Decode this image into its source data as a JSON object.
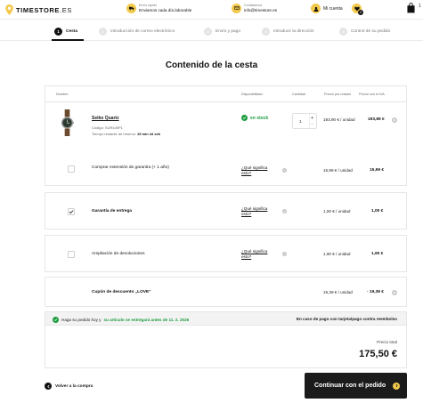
{
  "header": {
    "brand": "TIMESTORE",
    "brand_tld": ".ES",
    "shipping_small": "Envío rápido",
    "shipping_big": "Enviamos cada día laborable",
    "contact_small": "Contáctenos",
    "contact_big": "info@timestore.es",
    "account_label": "Mi cuenta",
    "favorites_count": "0",
    "cart_count": "1"
  },
  "steps": [
    {
      "num": "1",
      "label": "Cesta"
    },
    {
      "num": "2",
      "label": "Introducción de correo electrónico"
    },
    {
      "num": "3",
      "label": "Envío y pago"
    },
    {
      "num": "4",
      "label": "Introducir la dirección"
    },
    {
      "num": "5",
      "label": "Control de su pedido"
    }
  ],
  "page_title": "Contenido de la cesta",
  "table_headers": {
    "name": "Nombre",
    "availability": "Disponibilidad",
    "quantity": "Cantidad",
    "unit_price": "Precio por unidad",
    "vat_price": "Precio con el IVA"
  },
  "product": {
    "name": "Seiko Quartz",
    "code": "Código: SUR449P1",
    "time_prefix": "Tiempo restante de reserva:",
    "time_value": "19 min 44 sek",
    "stock": "en stock",
    "qty": "1",
    "qty_plus": "+",
    "qty_minus": "−",
    "unit_price": "193,90 € / unidad",
    "total": "193,89 €"
  },
  "options": [
    {
      "label": "Comprar extensión de garantía (+ 1 año)",
      "link": "¿Qué significa esto?",
      "unit": "15,99 € / unidad",
      "total": "15,99 €",
      "checked": false
    },
    {
      "label": "Garantía de entrega",
      "link": "¿Qué significa esto?",
      "unit": "1,00 € / unidad",
      "total": "1,00 €",
      "checked": true
    },
    {
      "label": "Ampliación de devoluciones",
      "link": "¿Qué significa esto?",
      "unit": "1,90 € / unidad",
      "total": "1,90 €",
      "checked": false
    }
  ],
  "coupon": {
    "label": "Cupón de descuento „LOVE“",
    "unit": "19,39 € / unidad",
    "total": "- 19,39 €"
  },
  "delivery": {
    "prefix": "Haga su pedido hoy y",
    "highlight": "su artículo se entregará antes de 11. 2. 2026",
    "right": "En caso de pago con tarjeta/pago contra reembolso"
  },
  "summary": {
    "total_label": "Precio total",
    "total_value": "175,50 €"
  },
  "actions": {
    "back": "Volver a la compra",
    "continue": "Continuar con el pedido"
  },
  "colors": {
    "accent": "#f2c94c",
    "success": "#1a9c3e",
    "dark": "#1b1b1b"
  }
}
